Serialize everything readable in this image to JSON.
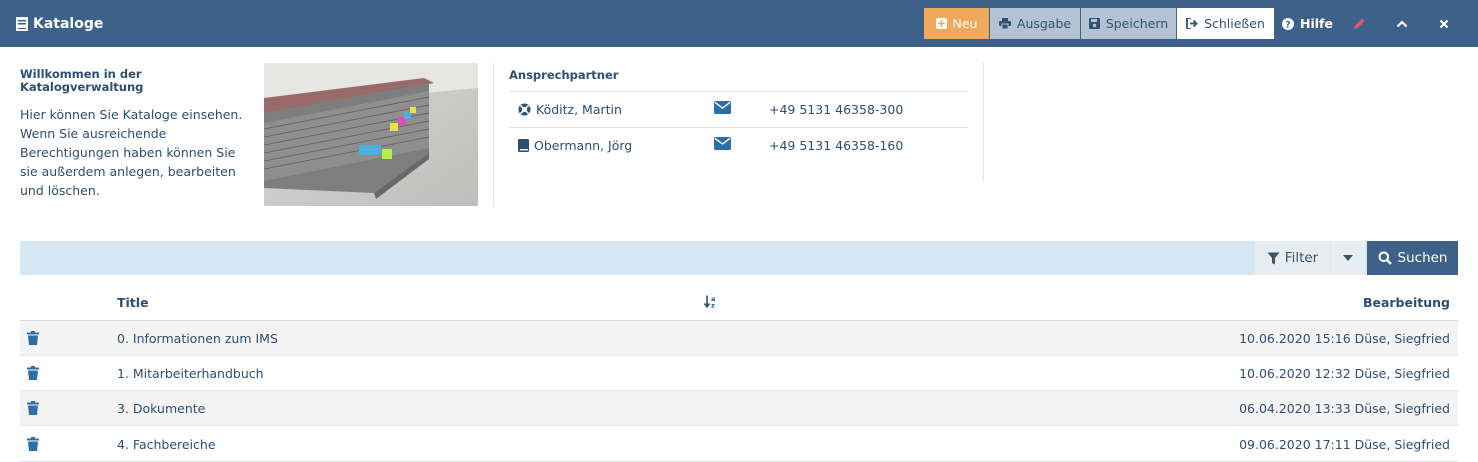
{
  "header": {
    "title": "Kataloge",
    "buttons": {
      "new": "Neu",
      "output": "Ausgabe",
      "save": "Speichern",
      "close": "Schließen",
      "help": "Hilfe"
    },
    "icons": [
      "catalog-icon",
      "plus-square-icon",
      "print-icon",
      "save-icon",
      "sign-out-icon",
      "question-circle-icon",
      "pencil-icon",
      "chevron-up-icon",
      "close-icon"
    ],
    "colors": {
      "bar": "#3e6189",
      "new_button": "#f0a85c",
      "secondary_button": "#b4c3d3"
    }
  },
  "intro": {
    "heading": "Willkommen in der Katalogverwaltung",
    "text": "Hier können Sie Kataloge einsehen. Wenn Sie ausreichende Berechtigungen haben können Sie sie außerdem anlegen, bearbeiten und löschen."
  },
  "contacts": {
    "title": "Ansprechpartner",
    "items": [
      {
        "name": "Köditz, Martin",
        "icon": "lifebuoy-icon",
        "phone": "+49 5131 46358-300"
      },
      {
        "name": "Obermann, Jörg",
        "icon": "book-icon",
        "phone": "+49 5131 46358-160"
      }
    ]
  },
  "filter": {
    "filter_label": "Filter",
    "search_label": "Suchen"
  },
  "table": {
    "columns": {
      "title": "Title",
      "edited": "Bearbeitung"
    },
    "rows": [
      {
        "title": "0. Informationen zum IMS",
        "edited": "10.06.2020 15:16 Düse, Siegfried"
      },
      {
        "title": "1. Mitarbeiterhandbuch",
        "edited": "10.06.2020 12:32 Düse, Siegfried"
      },
      {
        "title": "3. Dokumente",
        "edited": "06.04.2020 13:33 Düse, Siegfried"
      },
      {
        "title": "4. Fachbereiche",
        "edited": "09.06.2020 17:11 Düse, Siegfried"
      }
    ]
  }
}
